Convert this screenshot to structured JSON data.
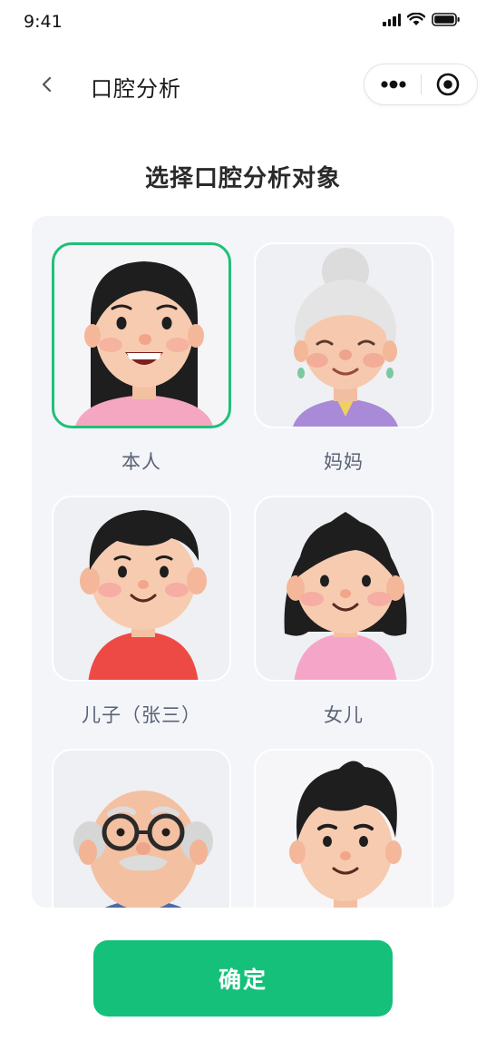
{
  "status_bar": {
    "time": "9:41"
  },
  "nav": {
    "title": "口腔分析"
  },
  "heading": "选择口腔分析对象",
  "members": [
    {
      "label": "本人",
      "selected": true,
      "avatar": "young-woman-avatar"
    },
    {
      "label": "妈妈",
      "selected": false,
      "avatar": "grandmother-avatar"
    },
    {
      "label": "儿子（张三）",
      "selected": false,
      "avatar": "boy-avatar"
    },
    {
      "label": "女儿",
      "selected": false,
      "avatar": "girl-avatar"
    },
    {
      "label": "",
      "selected": false,
      "avatar": "grandfather-avatar"
    },
    {
      "label": "",
      "selected": false,
      "avatar": "young-man-avatar"
    }
  ],
  "confirm_label": "确定",
  "colors": {
    "accent": "#15c07a",
    "selected_border": "#1fbf7a",
    "panel_bg": "#f3f5f9"
  }
}
